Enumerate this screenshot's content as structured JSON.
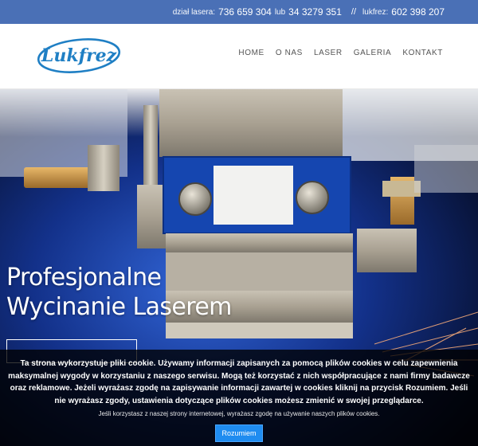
{
  "contact_bar": {
    "laser_label": "dział lasera:",
    "laser_phone": "736 659 304",
    "or": "lub",
    "laser_phone_alt": "34 3279 351",
    "separator": "//",
    "company_label": "lukfrez:",
    "company_phone": "602 398 207"
  },
  "logo": {
    "text": "Lukfrez",
    "color": "#1f7fc4"
  },
  "nav": {
    "items": [
      "HOME",
      "O NAS",
      "LASER",
      "GALERIA",
      "KONTAKT"
    ]
  },
  "hero": {
    "title_line1": "Profesjonalne",
    "title_line2": "Wycinanie Laserem"
  },
  "cookie_banner": {
    "message": "Ta strona wykorzystuje pliki cookie. Używamy informacji zapisanych za pomocą plików cookies w celu zapewnienia maksymalnej wygody w korzystaniu z naszego serwisu. Mogą też korzystać z nich współpracujące z nami firmy badawcze oraz reklamowe. Jeżeli wyrażasz zgodę na zapisywanie informacji zawartej w cookies kliknij na przycisk Rozumiem. Jeśli nie wyrażasz zgody, ustawienia dotyczące plików cookies możesz zmienić w swojej przeglądarce.",
    "note": "Jeśli korzystasz z naszej strony internetowej, wyrażasz zgodę na używanie naszych plików cookies.",
    "accept_label": "Rozumiem"
  },
  "colors": {
    "topbar": "#4a70b6",
    "accent": "#1f8cf0",
    "nav_text": "#555555"
  }
}
